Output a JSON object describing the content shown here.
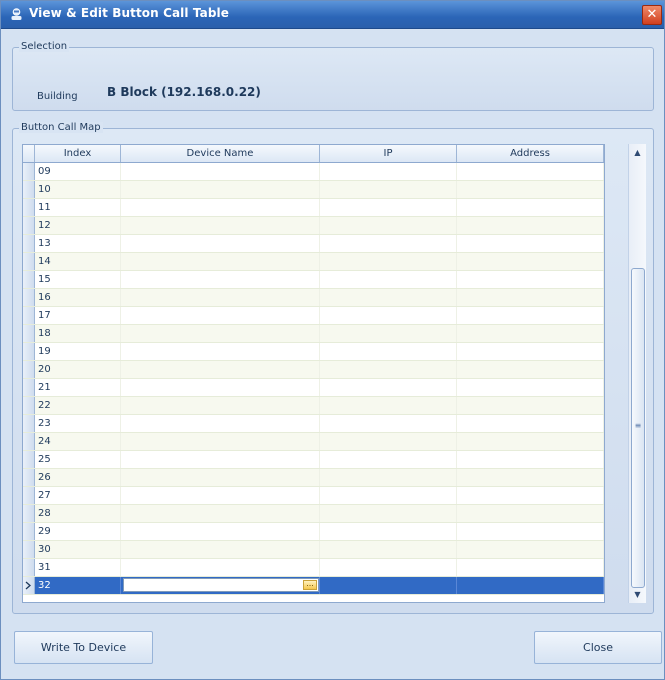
{
  "window": {
    "title": "View & Edit Button Call Table",
    "close_glyph": "✕"
  },
  "selection": {
    "group_title": "Selection",
    "building_label": "Building",
    "building_value": "B Block (192.168.0.22)"
  },
  "map": {
    "group_title": "Button Call Map",
    "columns": [
      "Index",
      "Device Name",
      "IP",
      "Address"
    ],
    "rows": [
      {
        "index": "09",
        "device_name": "",
        "ip": "",
        "address": ""
      },
      {
        "index": "10",
        "device_name": "",
        "ip": "",
        "address": ""
      },
      {
        "index": "11",
        "device_name": "",
        "ip": "",
        "address": ""
      },
      {
        "index": "12",
        "device_name": "",
        "ip": "",
        "address": ""
      },
      {
        "index": "13",
        "device_name": "",
        "ip": "",
        "address": ""
      },
      {
        "index": "14",
        "device_name": "",
        "ip": "",
        "address": ""
      },
      {
        "index": "15",
        "device_name": "",
        "ip": "",
        "address": ""
      },
      {
        "index": "16",
        "device_name": "",
        "ip": "",
        "address": ""
      },
      {
        "index": "17",
        "device_name": "",
        "ip": "",
        "address": ""
      },
      {
        "index": "18",
        "device_name": "",
        "ip": "",
        "address": ""
      },
      {
        "index": "19",
        "device_name": "",
        "ip": "",
        "address": ""
      },
      {
        "index": "20",
        "device_name": "",
        "ip": "",
        "address": ""
      },
      {
        "index": "21",
        "device_name": "",
        "ip": "",
        "address": ""
      },
      {
        "index": "22",
        "device_name": "",
        "ip": "",
        "address": ""
      },
      {
        "index": "23",
        "device_name": "",
        "ip": "",
        "address": ""
      },
      {
        "index": "24",
        "device_name": "",
        "ip": "",
        "address": ""
      },
      {
        "index": "25",
        "device_name": "",
        "ip": "",
        "address": ""
      },
      {
        "index": "26",
        "device_name": "",
        "ip": "",
        "address": ""
      },
      {
        "index": "27",
        "device_name": "",
        "ip": "",
        "address": ""
      },
      {
        "index": "28",
        "device_name": "",
        "ip": "",
        "address": ""
      },
      {
        "index": "29",
        "device_name": "",
        "ip": "",
        "address": ""
      },
      {
        "index": "30",
        "device_name": "",
        "ip": "",
        "address": ""
      },
      {
        "index": "31",
        "device_name": "",
        "ip": "",
        "address": ""
      },
      {
        "index": "32",
        "device_name": "",
        "ip": "",
        "address": "",
        "selected": true,
        "editing": true
      }
    ],
    "ellipsis_glyph": "..."
  },
  "scrollbar": {
    "up_glyph": "▲",
    "down_glyph": "▼",
    "grip_glyph": "≡"
  },
  "buttons": {
    "write_label": "Write To Device",
    "close_label": "Close"
  },
  "colors": {
    "selection": "#316ac5",
    "title_bar": "#2b65b7"
  }
}
